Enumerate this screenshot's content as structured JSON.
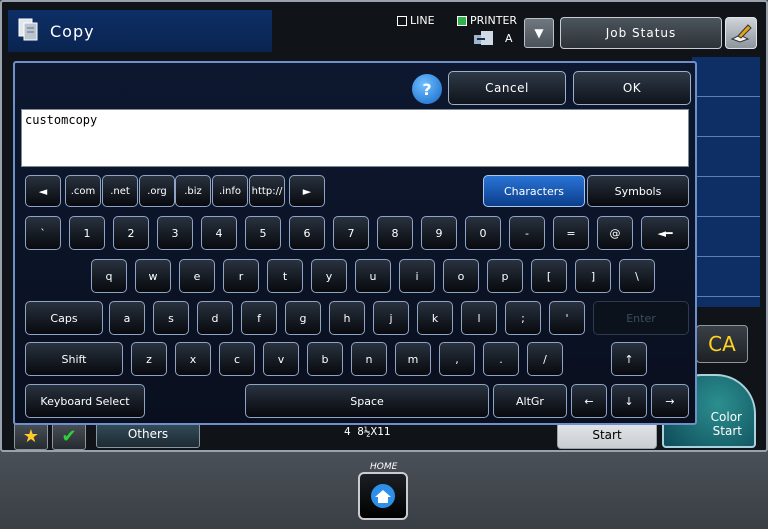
{
  "header": {
    "title": "Copy",
    "line_label": "LINE",
    "printer_label": "PRINTER",
    "printer_mode": "A",
    "job_status": "Job Status"
  },
  "background": {
    "ca_label": "CA",
    "bw_start": "Start",
    "color_start_line1": "Color",
    "color_start_line2": "Start",
    "others": "Others",
    "paper": "4 8½X11"
  },
  "keyboard": {
    "cancel": "Cancel",
    "ok": "OK",
    "input_value": "customcopy",
    "help": "?",
    "shortcuts": [
      ".com",
      ".net",
      ".org",
      ".biz",
      ".info",
      "http://"
    ],
    "mode_characters": "Characters",
    "mode_symbols": "Symbols",
    "row1": [
      "`",
      "1",
      "2",
      "3",
      "4",
      "5",
      "6",
      "7",
      "8",
      "9",
      "0",
      "-",
      "=",
      "@"
    ],
    "row2": [
      "q",
      "w",
      "e",
      "r",
      "t",
      "y",
      "u",
      "i",
      "o",
      "p",
      "[",
      "]",
      "\\"
    ],
    "row3": [
      "a",
      "s",
      "d",
      "f",
      "g",
      "h",
      "j",
      "k",
      "l",
      ";",
      "'"
    ],
    "row4": [
      "z",
      "x",
      "c",
      "v",
      "b",
      "n",
      "m",
      ",",
      ".",
      "/"
    ],
    "caps": "Caps",
    "enter": "Enter",
    "shift": "Shift",
    "keyboard_select": "Keyboard Select",
    "space": "Space",
    "altgr": "AltGr",
    "left_arrow": "◄",
    "right_arrow": "►",
    "backspace": "◄━",
    "up": "↑",
    "down": "↓",
    "key_left": "←",
    "key_right": "→"
  },
  "home": {
    "label": "HOME"
  },
  "colors": {
    "accent": "#1466c9",
    "panel": "#0d1830",
    "border": "#6f8fc9"
  }
}
